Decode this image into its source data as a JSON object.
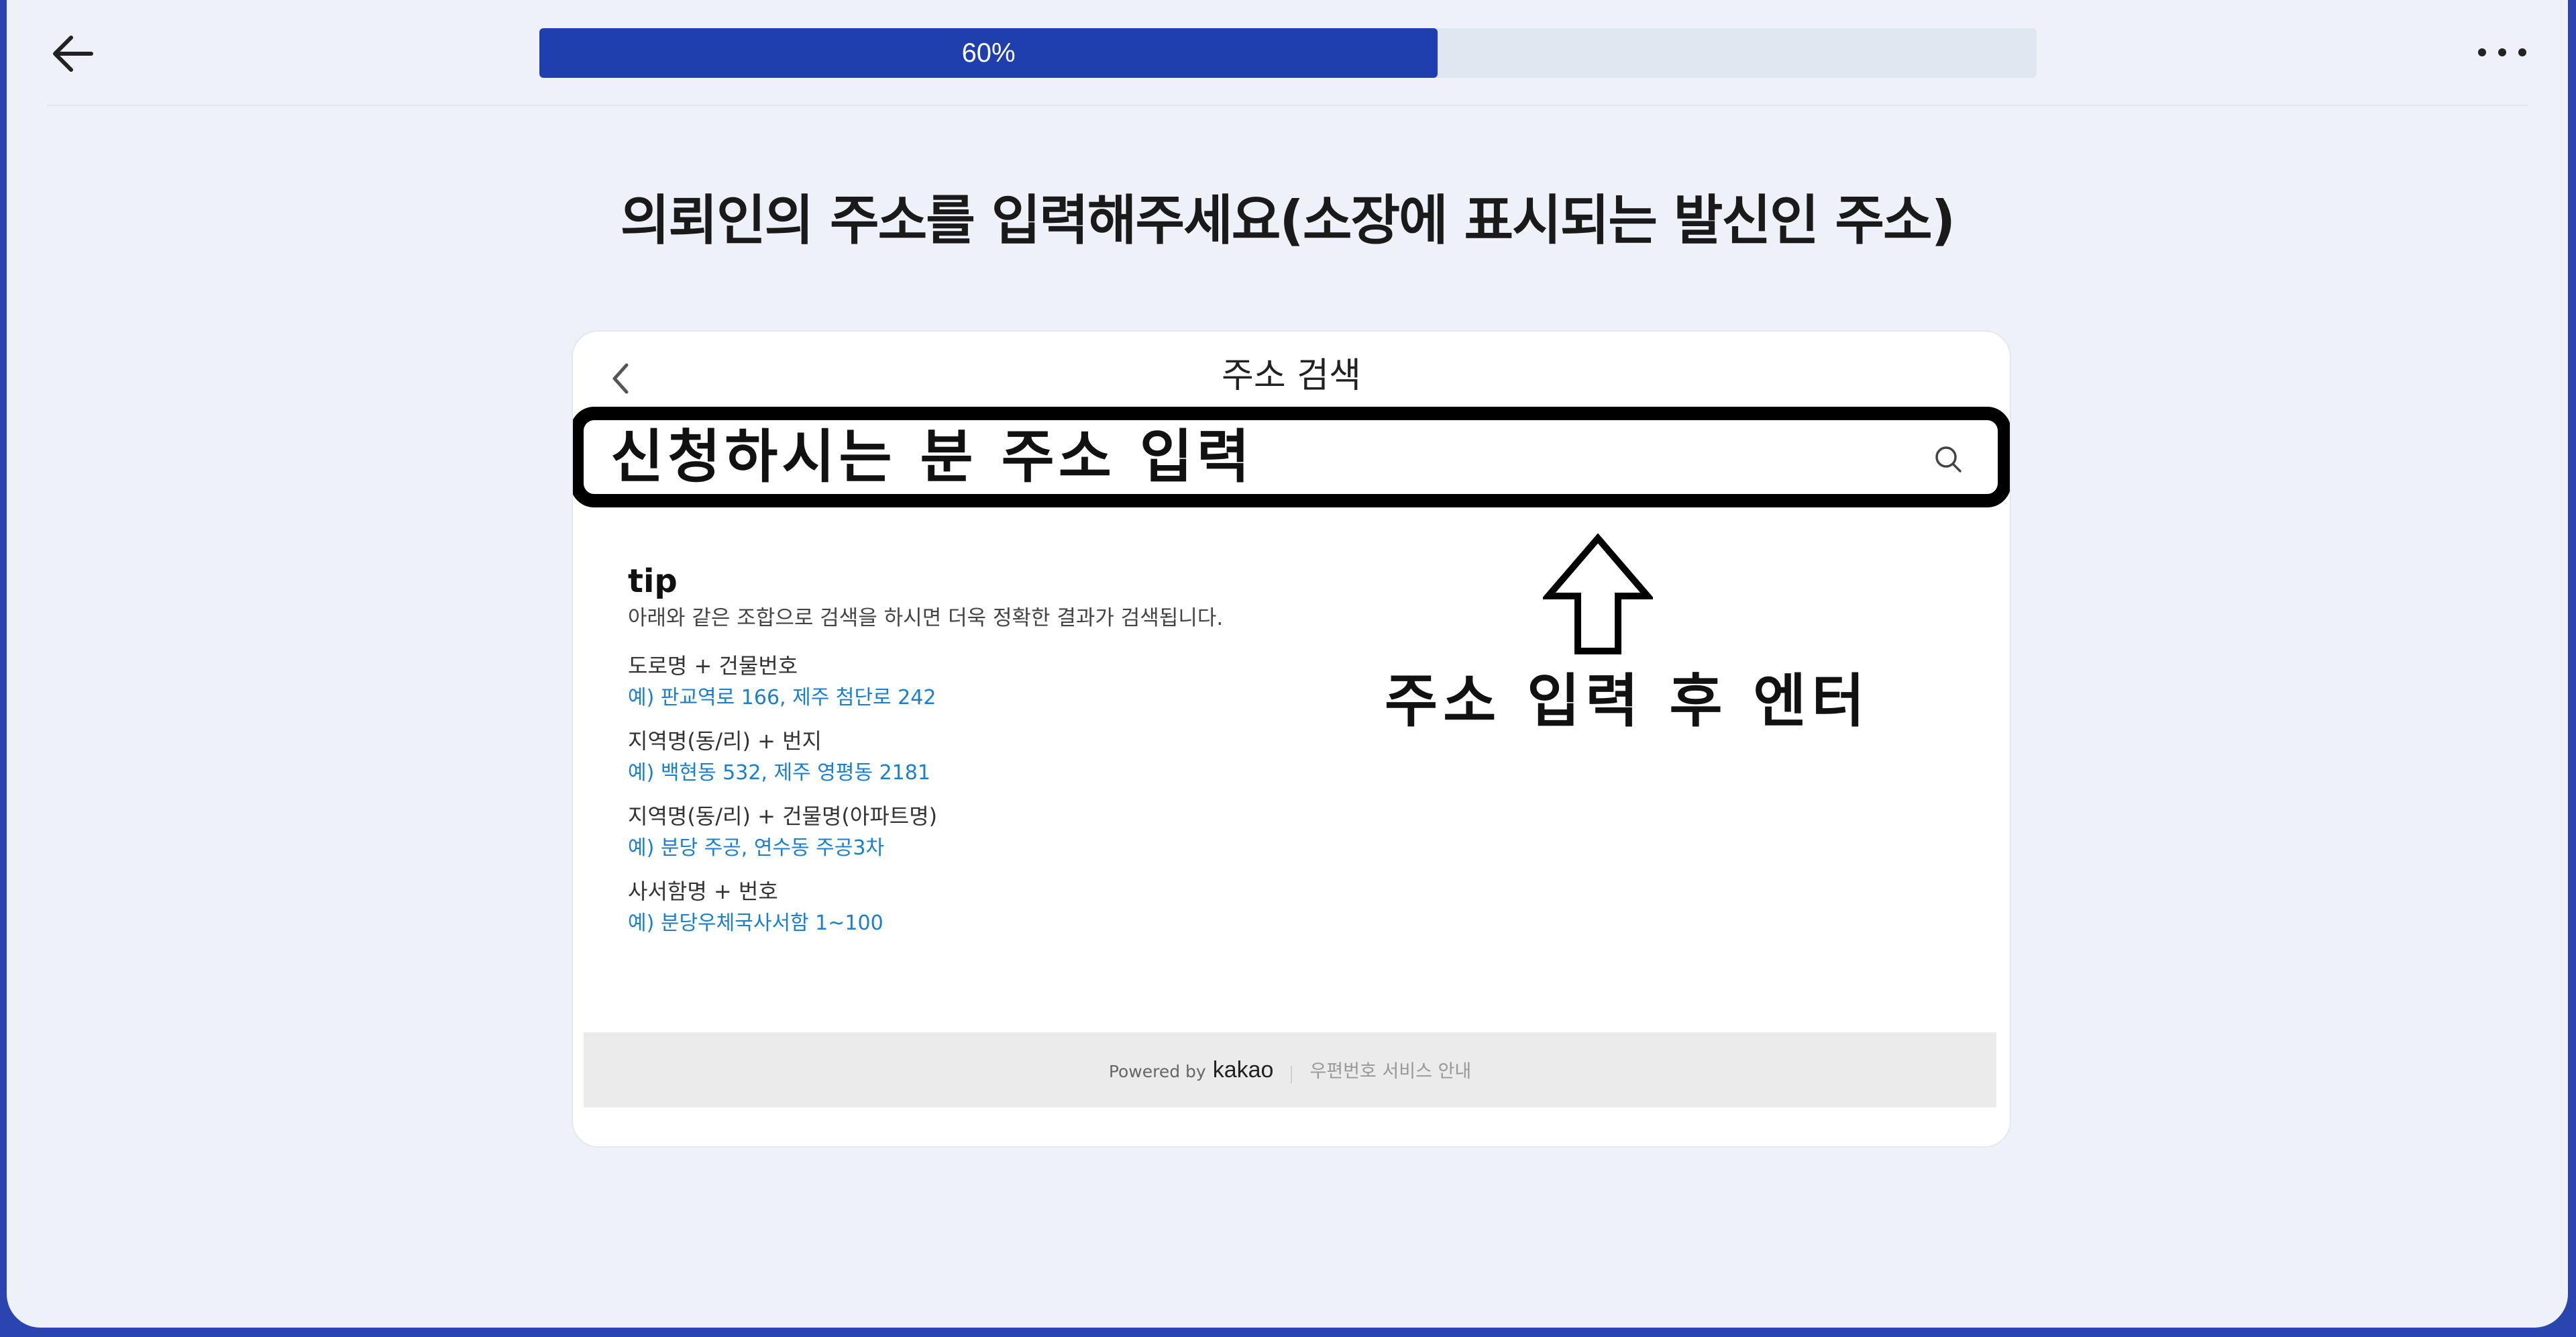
{
  "header": {
    "progress_percent": 60,
    "progress_label": "60%",
    "back_icon": "arrow-left-icon",
    "more_icon": "more-horizontal-icon",
    "progress_color": "#1f3fae"
  },
  "page": {
    "title": "의뢰인의 주소를 입력해주세요(소장에 표시되는 발신인 주소)"
  },
  "address_search": {
    "title": "주소 검색",
    "back_icon": "chevron-left-icon",
    "search_icon": "search-icon",
    "input_text": "신청하시는 분 주소 입력",
    "tip_title": "tip",
    "tip_desc": "아래와 같은 조합으로 검색을 하시면 더욱 정확한 결과가 검색됩니다.",
    "tips": [
      {
        "label": "도로명 + 건물번호",
        "example": "예) 판교역로 166,  제주 첨단로 242"
      },
      {
        "label": "지역명(동/리) + 번지",
        "example": "예) 백현동 532,  제주 영평동 2181"
      },
      {
        "label": "지역명(동/리) + 건물명(아파트명)",
        "example": "예) 분당 주공,  연수동 주공3차"
      },
      {
        "label": "사서함명 + 번호",
        "example": "예) 분당우체국사서함 1~100"
      }
    ],
    "footer": {
      "powered_by": "Powered by",
      "brand": "kakao",
      "postal_link": "우편번호 서비스 안내"
    },
    "example_color": "#1a7fd0"
  },
  "annotation": {
    "text": "주소 입력 후 엔터",
    "arrow_icon": "arrow-up-outline-icon"
  }
}
